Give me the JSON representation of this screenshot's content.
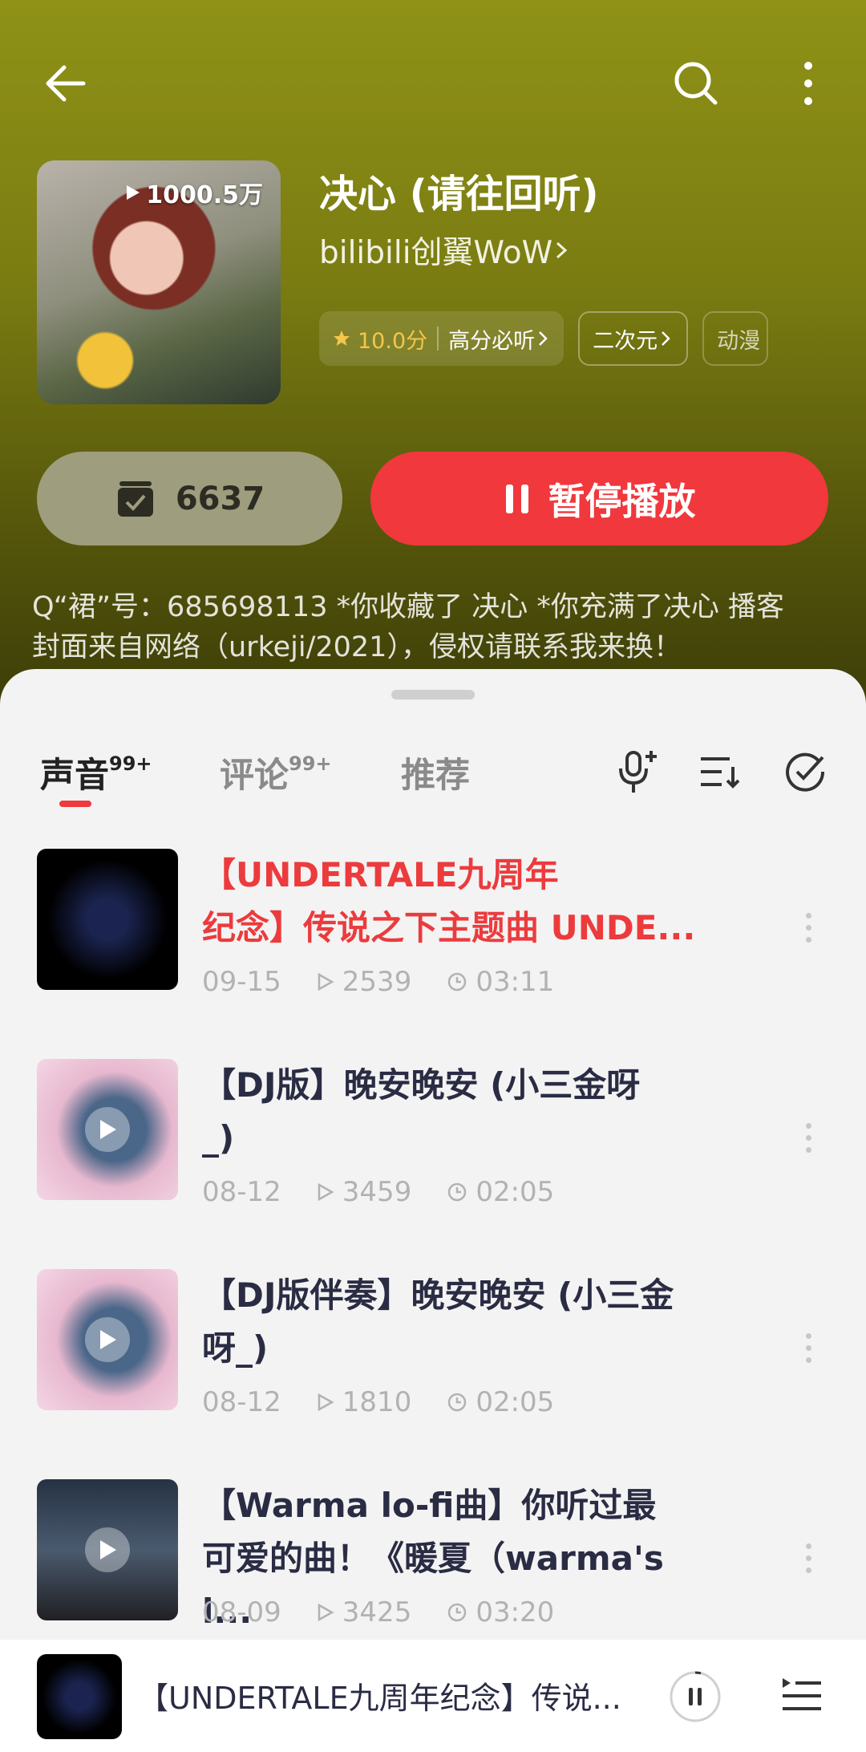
{
  "header": {
    "icons": [
      "back-arrow-icon",
      "search-icon",
      "more-vertical-icon"
    ]
  },
  "album": {
    "play_count": "1000.5万",
    "title": "决心 (请往回听)",
    "author": "bilibili创翼WoW",
    "score": "10.0分",
    "score_label": "高分必听",
    "tags": [
      "二次元",
      "动漫"
    ],
    "fav_count": "6637",
    "play_label": "暂停播放",
    "desc_line1": "Q“裙”号：685698113 *你收藏了 决心 *你充满了决心 播客",
    "desc_line2": "封面来自网络（urkeji/2021），侵权请联系我来换！"
  },
  "tabs": [
    {
      "label": "声音",
      "badge": "99+"
    },
    {
      "label": "评论",
      "badge": "99+"
    },
    {
      "label": "推荐",
      "badge": ""
    }
  ],
  "tracks": [
    {
      "line1": "【UNDERTALE九周年",
      "line2": "纪念】传说之下主题曲 UNDE...",
      "date": "09-15",
      "plays": "2539",
      "duration": "03:11"
    },
    {
      "line1": "【DJ版】晚安晚安 (小三金呀",
      "line2": "_)",
      "date": "08-12",
      "plays": "3459",
      "duration": "02:05"
    },
    {
      "line1": "【DJ版伴奏】晚安晚安 (小三金",
      "line2": "呀_)",
      "date": "08-12",
      "plays": "1810",
      "duration": "02:05"
    },
    {
      "line1": "【Warma lo-fi曲】你听过最",
      "line2": "可爱的曲！《暖夏（warma's l...",
      "date": "08-09",
      "plays": "3425",
      "duration": "03:20"
    }
  ],
  "mini_player": {
    "title": "【UNDERTALE九周年纪念】传说..."
  },
  "colors": {
    "accent": "#f0383d",
    "header": "#7a7c12"
  }
}
